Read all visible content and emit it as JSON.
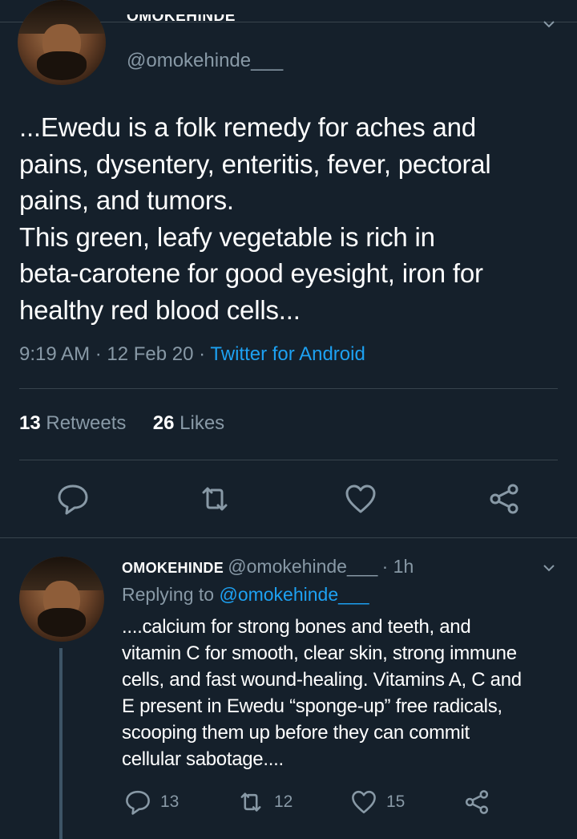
{
  "main_tweet": {
    "author_name": "OMOKEHINDE",
    "handle": "@omokehinde___",
    "text": "...Ewedu is a folk remedy for aches and\npains, dysentery, enteritis, fever, pectoral\npains, and tumors.\nThis green, leafy vegetable is rich in\nbeta-carotene for good eyesight, iron for\nhealthy red blood cells...",
    "time": "9:19 AM",
    "date": "12 Feb 20",
    "separator": "·",
    "source": "Twitter for Android",
    "retweets_count": "13",
    "retweets_label": "Retweets",
    "likes_count": "26",
    "likes_label": "Likes",
    "actions": [
      "reply-icon",
      "retweet-icon",
      "like-icon",
      "share-icon"
    ]
  },
  "reply_tweet": {
    "author_name": "OMOKEHINDE",
    "handle": "@omokehinde___",
    "age": "· 1h",
    "replying_label": "Replying to",
    "replying_to": "@omokehinde___",
    "text": "....calcium for strong bones and teeth, and\nvitamin C for smooth, clear skin, strong immune\ncells, and fast wound-healing. Vitamins A, C and\nE present in Ewedu “sponge-up” free radicals,\nscooping them up before they can commit\ncellular sabotage....",
    "reply_count": "13",
    "retweet_count": "12",
    "like_count": "15"
  },
  "colors": {
    "background": "#15202b",
    "divider": "#38444d",
    "secondary_text": "#8899a6",
    "accent": "#1da1f2"
  }
}
